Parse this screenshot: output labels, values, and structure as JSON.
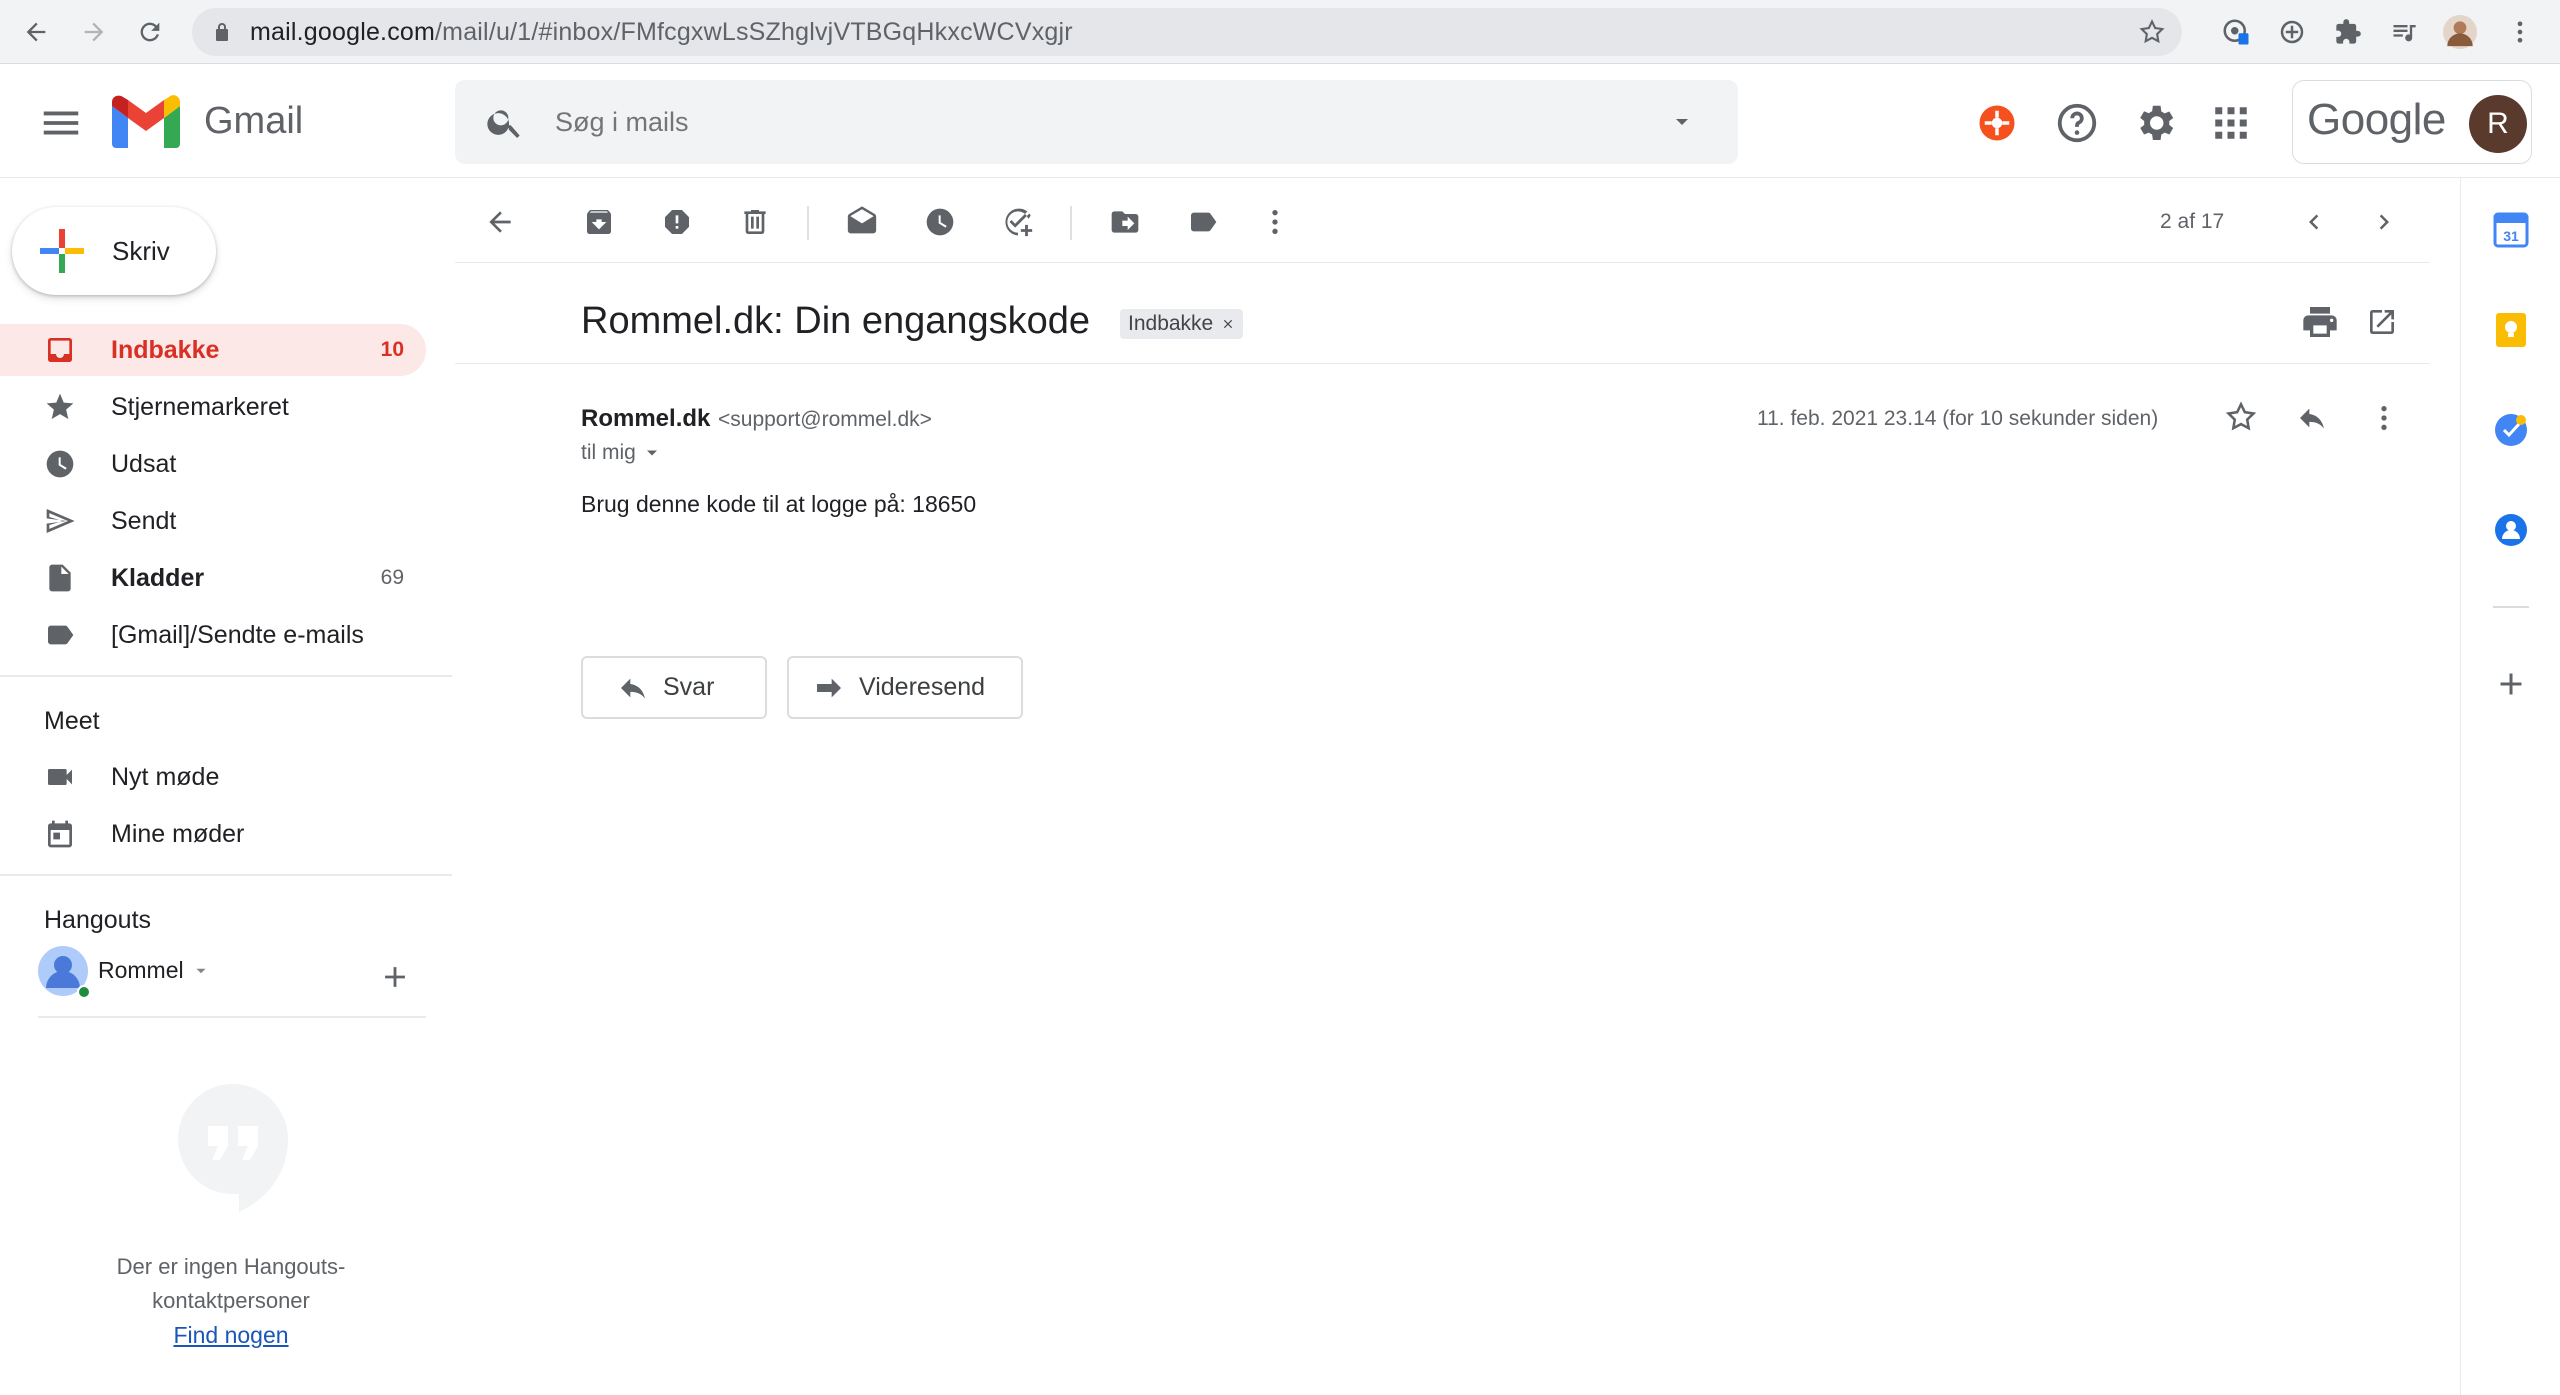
{
  "browser": {
    "url_host": "mail.google.com",
    "url_path": "/mail/u/1/#inbox/FMfcgxwLsSZhglvjVTBGqHkxcWCVxgjr"
  },
  "header": {
    "app_name": "Gmail",
    "search_placeholder": "Søg i mails",
    "google_word": "Google",
    "avatar_letter": "R"
  },
  "sidebar": {
    "compose_label": "Skriv",
    "items": [
      {
        "label": "Indbakke",
        "count": "10"
      },
      {
        "label": "Stjernemarkeret",
        "count": ""
      },
      {
        "label": "Udsat",
        "count": ""
      },
      {
        "label": "Sendt",
        "count": ""
      },
      {
        "label": "Kladder",
        "count": "69"
      },
      {
        "label": "[Gmail]/Sendte e-mails",
        "count": ""
      }
    ],
    "meet": {
      "title": "Meet",
      "items": [
        {
          "label": "Nyt møde"
        },
        {
          "label": "Mine møder"
        }
      ]
    },
    "hangouts": {
      "title": "Hangouts",
      "user": "Rommel",
      "empty_line1": "Der er ingen Hangouts-",
      "empty_line2": "kontaktpersoner",
      "find_link": "Find nogen"
    }
  },
  "toolbar": {
    "pager": "2 af 17"
  },
  "message": {
    "subject": "Rommel.dk: Din engangskode",
    "label_chip": "Indbakke",
    "sender_name": "Rommel.dk",
    "sender_email": "<support@rommel.dk>",
    "to": "til mig",
    "date": "11. feb. 2021 23.14 (for 10 sekunder siden)",
    "body": "Brug denne kode til at logge på: 18650",
    "reply_label": "Svar",
    "forward_label": "Videresend"
  },
  "colors": {
    "accent_red": "#d93025",
    "active_bg": "#fce8e6",
    "link_blue": "#1a56b8"
  },
  "icons": {
    "nav": [
      "inbox-icon",
      "star-icon",
      "clock-icon",
      "send-icon",
      "draft-icon",
      "label-icon"
    ],
    "toolbar": [
      "back-arrow-icon",
      "archive-icon",
      "spam-icon",
      "trash-icon",
      "mark-unread-icon",
      "snooze-icon",
      "add-task-icon",
      "move-to-icon",
      "label-icon",
      "more-vert-icon"
    ]
  }
}
